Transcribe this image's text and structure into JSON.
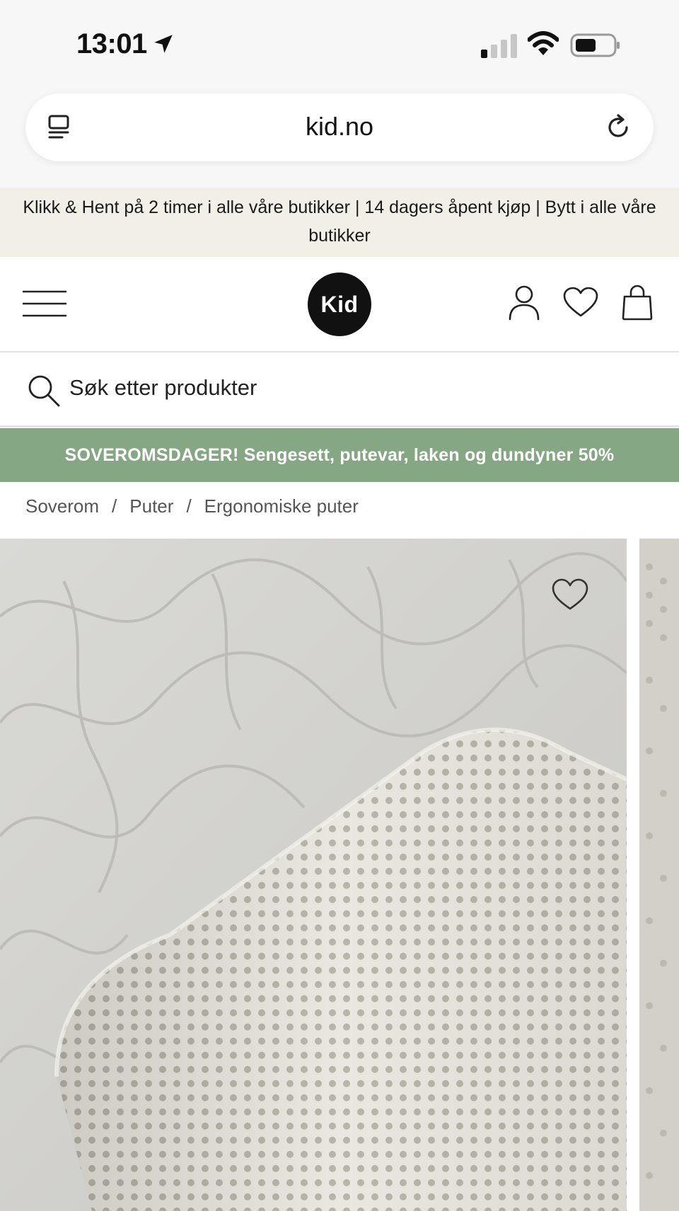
{
  "status_bar": {
    "time": "13:01",
    "icons": [
      "location-arrow-icon",
      "cellular-signal-icon",
      "wifi-icon",
      "battery-icon"
    ]
  },
  "browser": {
    "url": "kid.no",
    "icons": [
      "reader-mode-icon",
      "reload-icon"
    ]
  },
  "announcement": {
    "text": "Klikk & Hent på 2 timer i alle våre butikker | 14 dagers åpent kjøp | Bytt i alle våre butikker"
  },
  "header": {
    "logo_text": "Kid",
    "icons": [
      "hamburger-menu-icon",
      "account-icon",
      "wishlist-heart-icon",
      "shopping-bag-icon"
    ]
  },
  "search": {
    "placeholder": "Søk etter produkter"
  },
  "promo": {
    "text": "SOVEROMSDAGER! Sengesett, putevar, laken og dundyner 50%",
    "color": "#86a784"
  },
  "breadcrumb": {
    "items": [
      "Soverom",
      "Puter",
      "Ergonomiske puter"
    ],
    "separator": "/"
  },
  "product_gallery": {
    "icons": [
      "favorite-heart-icon"
    ]
  }
}
